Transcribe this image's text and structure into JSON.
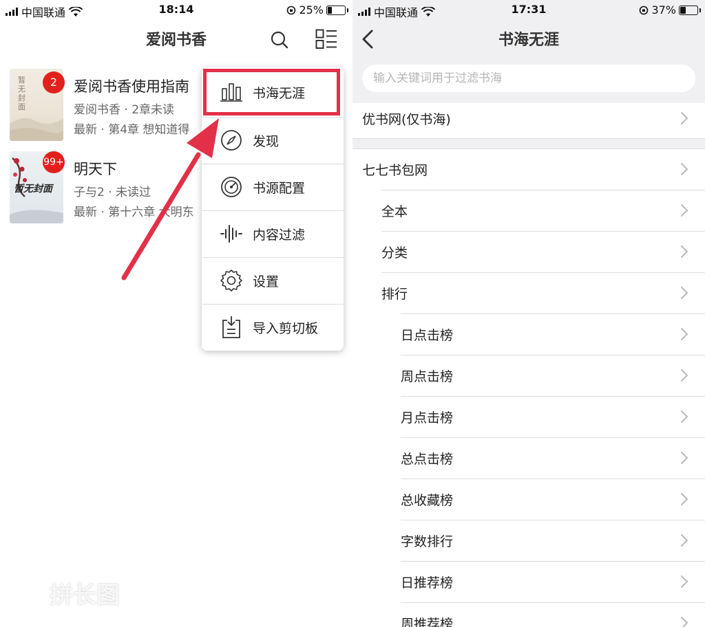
{
  "left": {
    "status": {
      "carrier": "中国联通",
      "time": "18:14",
      "battery": "25%",
      "battery_level": 0.25
    },
    "title": "爱阅书香",
    "books": [
      {
        "title": "爱阅书香使用指南",
        "meta": "爱阅书香 · 2章未读",
        "latest": "最新 · 第4章 想知道得",
        "badge": "2",
        "cover_text": "暂无封面"
      },
      {
        "title": "明天下",
        "meta": "子与2 · 未读过",
        "latest": "最新 · 第十六章 大明东",
        "badge": "99+",
        "cover_text": "暂无封面"
      }
    ],
    "menu": [
      {
        "label": "书海无涯",
        "icon": "bar-chart-icon"
      },
      {
        "label": "发现",
        "icon": "compass-icon"
      },
      {
        "label": "书源配置",
        "icon": "gauge-icon"
      },
      {
        "label": "内容过滤",
        "icon": "waveform-icon"
      },
      {
        "label": "设置",
        "icon": "gear-icon"
      },
      {
        "label": "导入剪切板",
        "icon": "clipboard-import-icon"
      }
    ],
    "watermark": "拼长图",
    "highlight_color": "#e33049"
  },
  "right": {
    "status": {
      "carrier": "中国联通",
      "time": "17:31",
      "battery": "37%",
      "battery_level": 0.37
    },
    "title": "书海无涯",
    "search_placeholder": "输入关键词用于过滤书海",
    "group1": [
      {
        "label": "优书网(仅书海)"
      }
    ],
    "group2": [
      {
        "label": "七七书包网",
        "level": 0
      },
      {
        "label": "全本",
        "level": 1
      },
      {
        "label": "分类",
        "level": 1
      },
      {
        "label": "排行",
        "level": 1
      },
      {
        "label": "日点击榜",
        "level": 2
      },
      {
        "label": "周点击榜",
        "level": 2
      },
      {
        "label": "月点击榜",
        "level": 2
      },
      {
        "label": "总点击榜",
        "level": 2
      },
      {
        "label": "总收藏榜",
        "level": 2
      },
      {
        "label": "字数排行",
        "level": 2
      },
      {
        "label": "日推荐榜",
        "level": 2
      },
      {
        "label": "周推荐榜",
        "level": 2
      }
    ]
  }
}
